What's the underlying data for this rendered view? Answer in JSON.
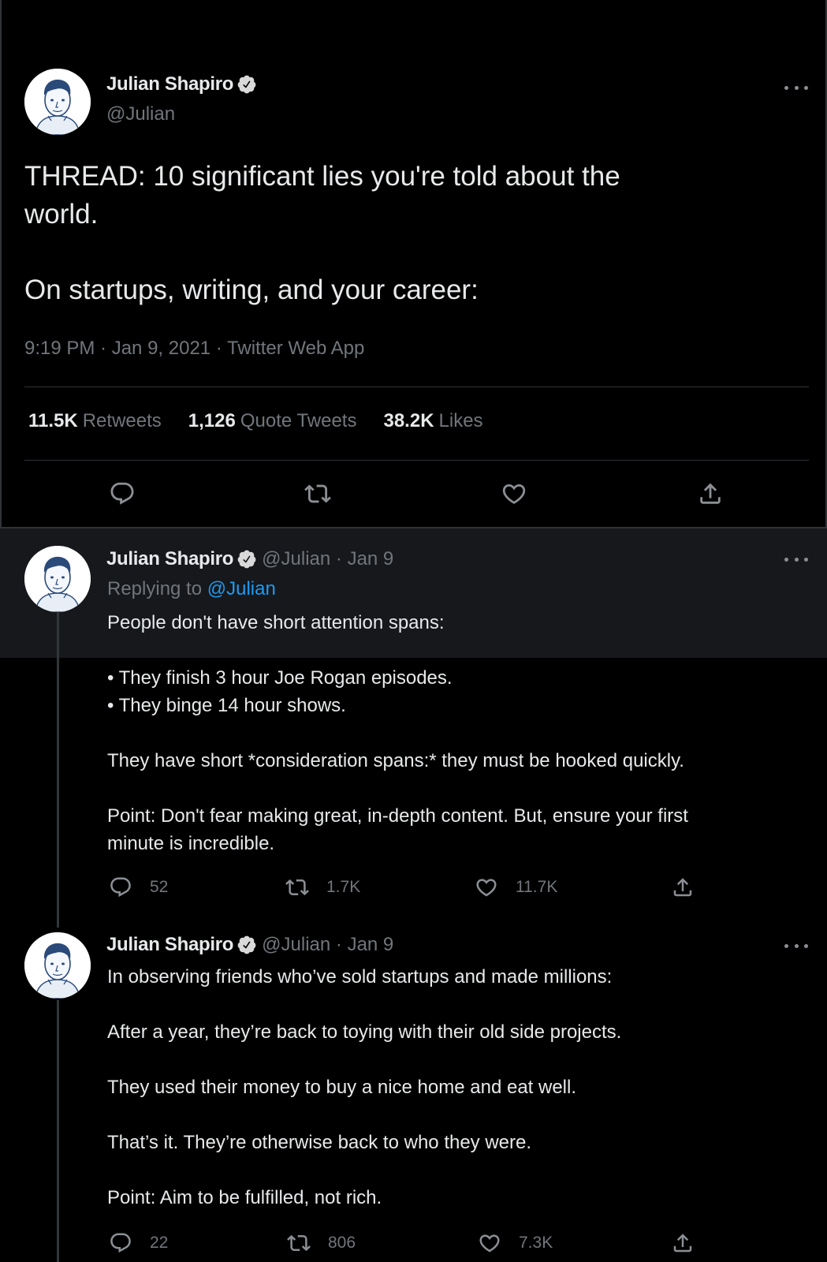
{
  "main_tweet": {
    "author_name": "Julian Shapiro",
    "author_handle": "@Julian",
    "text_lines": [
      "THREAD: 10 significant lies you're told about the",
      "world.",
      "",
      "On startups, writing, and your career:"
    ],
    "meta": "9:19 PM · Jan 9, 2021 · Twitter Web App",
    "stats": [
      {
        "value": "11.5K",
        "label": "Retweets"
      },
      {
        "value": "1,126",
        "label": "Quote Tweets"
      },
      {
        "value": "38.2K",
        "label": "Likes"
      }
    ]
  },
  "replies": [
    {
      "author_name": "Julian Shapiro",
      "author_handle_date": "@Julian · Jan 9",
      "replying_prefix": "Replying to",
      "replying_to": "@Julian",
      "lines": [
        "People don't have short attention spans:",
        "",
        "• They finish 3 hour Joe Rogan episodes.",
        "• They binge 14 hour shows.",
        "",
        "They have short *consideration spans:* they must be hooked quickly.",
        "",
        "Point: Don't fear making great, in-depth content. But, ensure your first",
        "minute is incredible."
      ],
      "counts": {
        "replies": "52",
        "retweets": "1.7K",
        "likes": "11.7K"
      }
    },
    {
      "author_name": "Julian Shapiro",
      "author_handle_date": "@Julian · Jan 9",
      "lines": [
        "In observing friends who’ve sold startups and made millions:",
        "",
        "After a year, they’re back to toying with their old side projects.",
        "",
        "They used their money to buy a nice home and eat well.",
        "",
        "That’s it. They’re otherwise back to who they were.",
        "",
        "Point: Aim to be fulfilled, not rich."
      ],
      "counts": {
        "replies": "22",
        "retweets": "806",
        "likes": "7.3K"
      }
    }
  ],
  "colors": {
    "background": "#000000",
    "highlight_row": "#16181c",
    "link": "#1d9bf0",
    "verified": "#d9d9d9",
    "secondary_text": "#71767b"
  },
  "icons": [
    "avatar",
    "verified-badge-icon",
    "more-icon",
    "reply-icon",
    "retweet-icon",
    "like-icon",
    "share-icon"
  ]
}
